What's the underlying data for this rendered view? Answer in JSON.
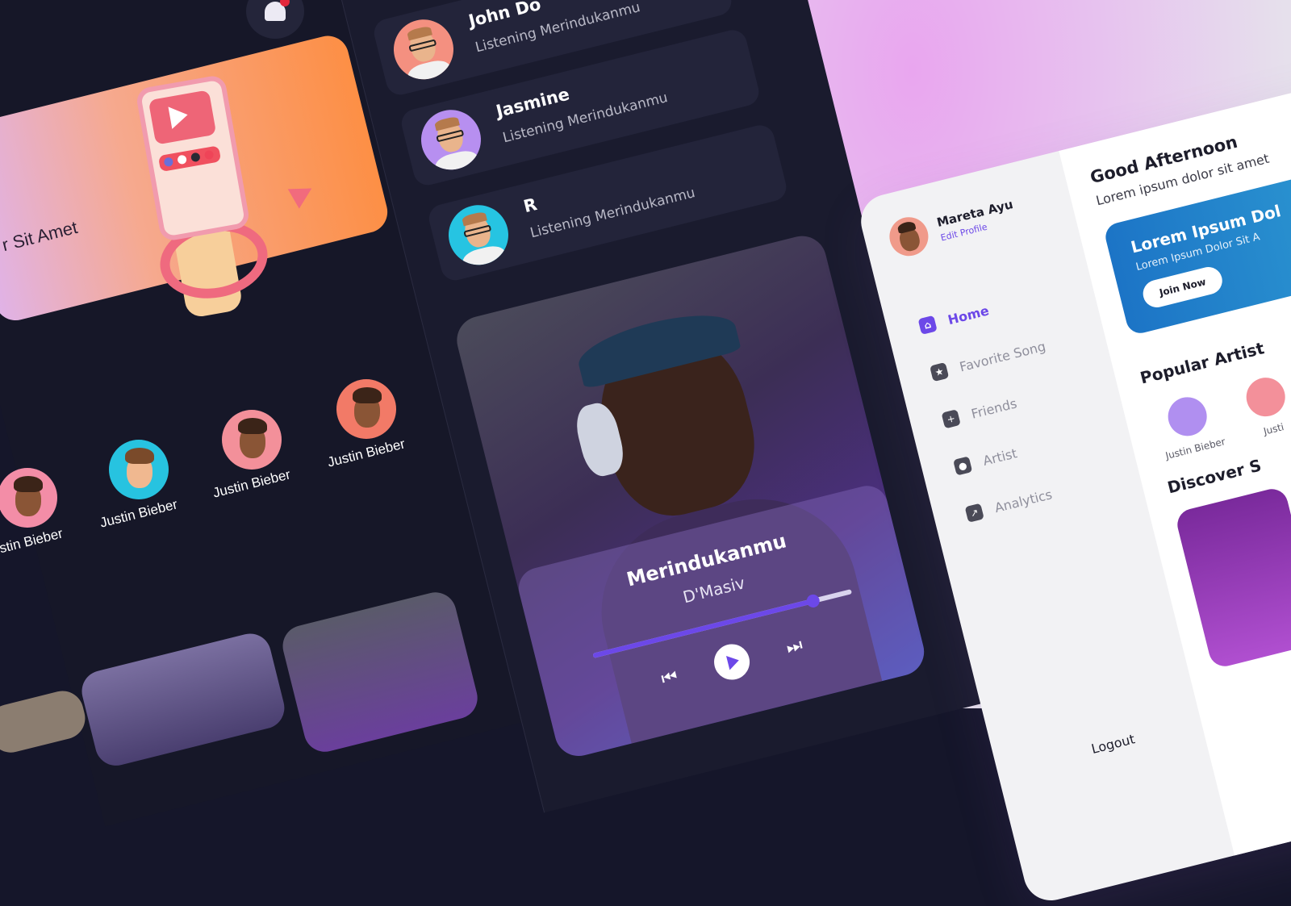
{
  "left_panel": {
    "promo_text": "r Sit Amet",
    "artists": [
      {
        "name": "ustin Bieber"
      },
      {
        "name": "Justin Bieber"
      },
      {
        "name": "Justin Bieber"
      },
      {
        "name": "Justin Bieber"
      }
    ]
  },
  "friends": [
    {
      "name": "John Do",
      "status": "Listening Merindukanmu"
    },
    {
      "name": "Jasmine",
      "status": "Listening Merindukanmu"
    },
    {
      "name": "R",
      "status": "Listening Merindukanmu"
    }
  ],
  "player": {
    "title": "Merindukanmu",
    "artist": "D'Masiv",
    "progress": 0.85,
    "prev_icon": "⏮",
    "next_icon": "⏭"
  },
  "app": {
    "profile": {
      "name": "Mareta Ayu",
      "edit": "Edit Profile"
    },
    "nav": [
      {
        "label": "Home",
        "icon": "home-icon",
        "glyph": "⌂",
        "active": true
      },
      {
        "label": "Favorite Song",
        "icon": "star-icon",
        "glyph": "★",
        "active": false
      },
      {
        "label": "Friends",
        "icon": "add-user-icon",
        "glyph": "+",
        "active": false
      },
      {
        "label": "Artist",
        "icon": "user-icon",
        "glyph": "●",
        "active": false
      },
      {
        "label": "Analytics",
        "icon": "analytics-icon",
        "glyph": "↗",
        "active": false
      }
    ],
    "logout": "Logout",
    "greeting": "Good Afternoon",
    "greeting_sub": "Lorem ipsum dolor sit amet",
    "banner": {
      "title": "Lorem Ipsum Dol",
      "subtitle": "Lorem Ipsum Dolor Sit A",
      "button": "Join Now"
    },
    "popular_title": "Popular Artist",
    "popular": [
      {
        "name": "Justin Bieber"
      },
      {
        "name": "Justi"
      }
    ],
    "discover_title": "Discover S"
  },
  "colors": {
    "accent": "#6c48e8",
    "dark_bg": "#161728",
    "card": "#23243a"
  }
}
